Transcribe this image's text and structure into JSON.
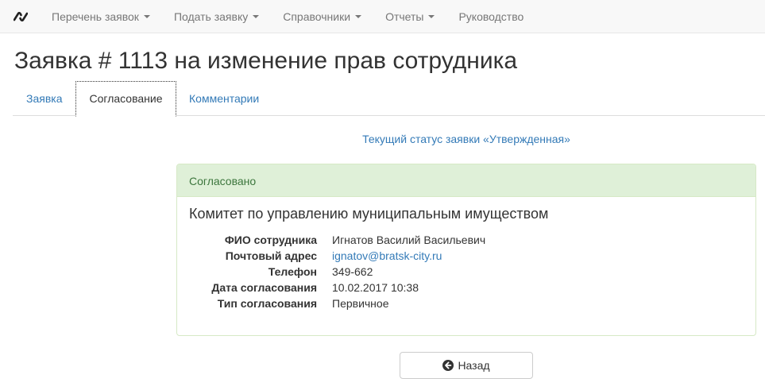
{
  "navbar": {
    "brand_icon": "brand-logo-icon",
    "items": [
      {
        "label": "Перечень заявок",
        "dropdown": true
      },
      {
        "label": "Подать заявку",
        "dropdown": true
      },
      {
        "label": "Справочники",
        "dropdown": true
      },
      {
        "label": "Отчеты",
        "dropdown": true
      },
      {
        "label": "Руководство",
        "dropdown": false
      }
    ]
  },
  "page": {
    "title": "Заявка # 1113 на изменение прав сотрудника"
  },
  "tabs": [
    {
      "label": "Заявка",
      "active": false
    },
    {
      "label": "Согласование",
      "active": true
    },
    {
      "label": "Комментарии",
      "active": false
    }
  ],
  "status_text": "Текущий статус заявки «Утвержденная»",
  "panel": {
    "heading": "Согласовано",
    "title": "Комитет по управлению муниципальным имуществом",
    "fields": [
      {
        "label": "ФИО сотрудника",
        "value": "Игнатов Василий Васильевич"
      },
      {
        "label": "Почтовый адрес",
        "value": "ignatov@bratsk-city.ru"
      },
      {
        "label": "Телефон",
        "value": "349-662"
      },
      {
        "label": "Дата согласования",
        "value": "10.02.2017 10:38"
      },
      {
        "label": "Тип согласования",
        "value": "Первичное"
      }
    ]
  },
  "back_button": {
    "label": "Назад",
    "icon": "circle-arrow-left-icon"
  },
  "colors": {
    "link": "#337ab7",
    "success_bg": "#dff0d8",
    "success_text": "#3c763d",
    "navbar_bg": "#f8f8f8"
  }
}
